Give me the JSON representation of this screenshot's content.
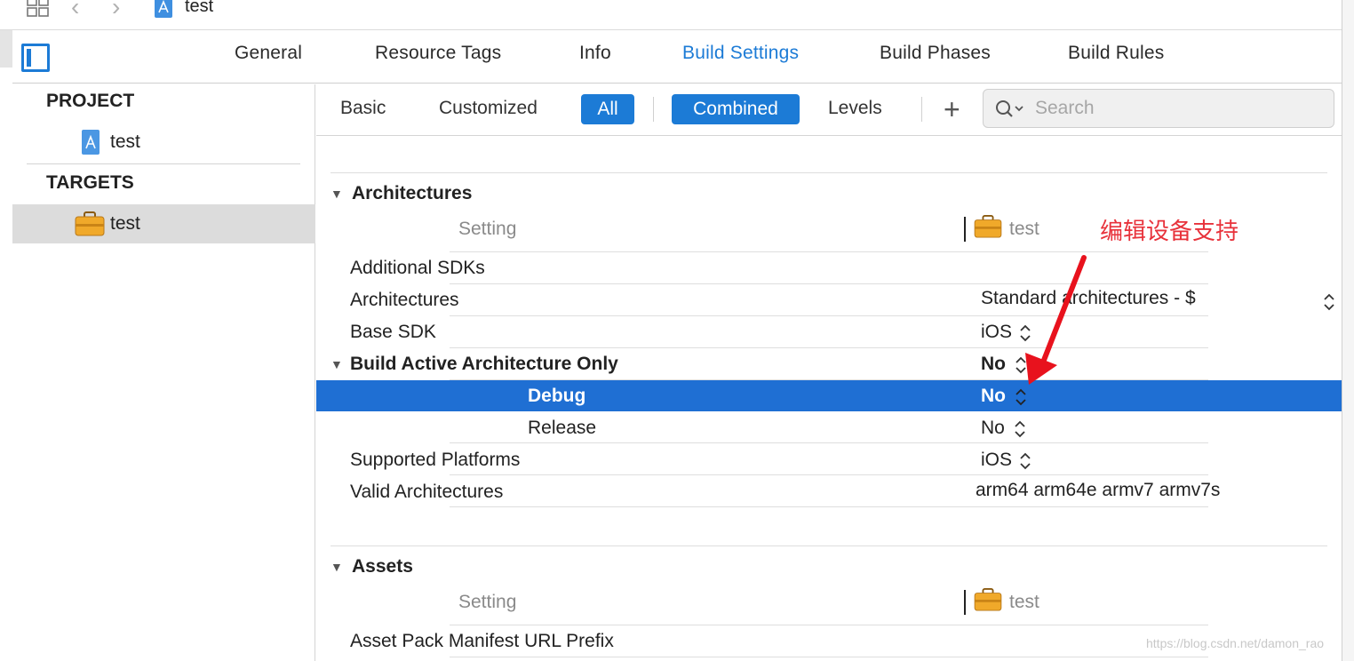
{
  "breadcrumb": {
    "label": "test"
  },
  "tabs": [
    {
      "label": "General"
    },
    {
      "label": "Resource Tags"
    },
    {
      "label": "Info"
    },
    {
      "label": "Build Settings",
      "active": true
    },
    {
      "label": "Build Phases"
    },
    {
      "label": "Build Rules"
    }
  ],
  "sidebar": {
    "project_header": "PROJECT",
    "project_item": "test",
    "targets_header": "TARGETS",
    "target_item": "test"
  },
  "filters": {
    "basic": "Basic",
    "customized": "Customized",
    "all": "All",
    "combined": "Combined",
    "levels": "Levels",
    "add": "+"
  },
  "search": {
    "placeholder": "Search"
  },
  "sections": {
    "architectures": {
      "title": "Architectures",
      "col_setting": "Setting",
      "col_target": "test",
      "rows": {
        "additional_sdks": {
          "label": "Additional SDKs",
          "value": ""
        },
        "architectures": {
          "label": "Architectures",
          "value": "Standard architectures  -  $"
        },
        "base_sdk": {
          "label": "Base SDK",
          "value": "iOS"
        },
        "build_active": {
          "label": "Build Active Architecture Only",
          "value": "No"
        },
        "debug": {
          "label": "Debug",
          "value": "No"
        },
        "release": {
          "label": "Release",
          "value": "No"
        },
        "supported_platforms": {
          "label": "Supported Platforms",
          "value": "iOS"
        },
        "valid_architectures": {
          "label": "Valid Architectures",
          "value": "arm64 arm64e armv7 armv7s"
        }
      }
    },
    "assets": {
      "title": "Assets",
      "col_setting": "Setting",
      "col_target": "test",
      "rows": {
        "asset_pack_prefix": {
          "label": "Asset Pack Manifest URL Prefix",
          "value": ""
        }
      }
    }
  },
  "annotation": {
    "text": "编辑设备支持",
    "color": "#e8323b"
  },
  "watermark": "https://blog.csdn.net/damon_rao",
  "colors": {
    "accent": "#1c7bd6",
    "selection": "#1f6fd3"
  }
}
